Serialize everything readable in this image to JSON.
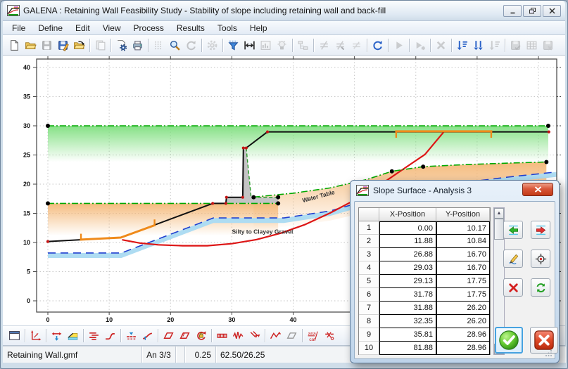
{
  "window": {
    "title": "GALENA : Retaining Wall Feasibility Study - Stability of slope including retaining wall and back-fill",
    "controls": [
      {
        "name": "minimize-button",
        "glyph": "minimize"
      },
      {
        "name": "restore-button",
        "glyph": "restore"
      },
      {
        "name": "close-button",
        "glyph": "close"
      }
    ]
  },
  "menu": {
    "items": [
      "File",
      "Define",
      "Edit",
      "View",
      "Process",
      "Results",
      "Tools",
      "Help"
    ]
  },
  "toolbar_top": {
    "items": [
      {
        "name": "new-file",
        "icon": "page"
      },
      {
        "name": "open-file",
        "icon": "folder"
      },
      {
        "name": "save-file",
        "icon": "floppy",
        "disabled": true
      },
      {
        "name": "save-edit-file",
        "icon": "floppy-pen"
      },
      {
        "name": "reopen-file",
        "icon": "folder-arrow"
      },
      {
        "sep": true
      },
      {
        "name": "paste",
        "icon": "paste",
        "disabled": true
      },
      {
        "sep": true
      },
      {
        "name": "page-setup",
        "icon": "page-gear"
      },
      {
        "name": "print",
        "icon": "printer"
      },
      {
        "sep": true
      },
      {
        "name": "grid-toggle",
        "icon": "grid-dots",
        "disabled": true
      },
      {
        "name": "zoom",
        "icon": "magnifier"
      },
      {
        "name": "redraw",
        "icon": "refresh",
        "disabled": true
      },
      {
        "sep": true
      },
      {
        "name": "settings",
        "icon": "gear",
        "disabled": true
      },
      {
        "sep": true
      },
      {
        "name": "filter",
        "icon": "funnel"
      },
      {
        "name": "fit-width",
        "icon": "fit-width"
      },
      {
        "name": "plot-options",
        "icon": "chart-frame",
        "disabled": true
      },
      {
        "name": "hint",
        "icon": "bulb",
        "disabled": true
      },
      {
        "sep": true
      },
      {
        "name": "model-tree",
        "icon": "tree",
        "disabled": true
      },
      {
        "sep": true
      },
      {
        "name": "edit-definition",
        "icon": "neq-pencil",
        "disabled": true
      },
      {
        "name": "edit-definition-alt",
        "icon": "neq-pencil2",
        "disabled": true
      },
      {
        "name": "edit-definition-lines",
        "icon": "neq-lines",
        "disabled": true
      },
      {
        "sep": true
      },
      {
        "name": "reprocess",
        "icon": "refresh-blue"
      },
      {
        "sep": true
      },
      {
        "name": "process",
        "icon": "play",
        "disabled": true
      },
      {
        "sep": true
      },
      {
        "name": "process-new",
        "icon": "play-star",
        "disabled": true
      },
      {
        "sep": true
      },
      {
        "name": "abort",
        "icon": "x-mark",
        "disabled": true
      },
      {
        "sep": true
      },
      {
        "name": "results-sort",
        "icon": "sort-lines"
      },
      {
        "name": "results-sort-all",
        "icon": "sort-double"
      },
      {
        "name": "results-sort-one",
        "icon": "sort-gray",
        "disabled": true
      },
      {
        "sep": true
      },
      {
        "name": "save-results",
        "icon": "floppy-check",
        "disabled": true
      },
      {
        "name": "results-table",
        "icon": "table-grid",
        "disabled": true
      },
      {
        "name": "clear-results",
        "icon": "floppy-x",
        "disabled": true
      }
    ]
  },
  "toolbar_bottom": {
    "items": [
      {
        "name": "page-frame",
        "icon": "win-frame"
      },
      {
        "sep": true
      },
      {
        "name": "axes-definition",
        "icon": "axes-red"
      },
      {
        "sep": true
      },
      {
        "name": "surface-profile",
        "icon": "prof-arrows"
      },
      {
        "name": "slope-batter",
        "icon": "slope-fill"
      },
      {
        "sep": true
      },
      {
        "name": "material-profiles",
        "icon": "multilines"
      },
      {
        "name": "profile-curve",
        "icon": "scurve"
      },
      {
        "sep": true
      },
      {
        "name": "water-table-define",
        "icon": "wt-icon"
      },
      {
        "name": "piezometric-surface",
        "icon": "piezo"
      },
      {
        "sep": true
      },
      {
        "name": "circular-surface",
        "icon": "para-red"
      },
      {
        "name": "circular-surface-multi",
        "icon": "para-red2"
      },
      {
        "name": "restraints",
        "icon": "lock-circ"
      },
      {
        "sep": true
      },
      {
        "name": "distributed-load",
        "icon": "dload"
      },
      {
        "name": "earthquake-load",
        "icon": "quake"
      },
      {
        "name": "point-load",
        "icon": "pload"
      },
      {
        "sep": true
      },
      {
        "name": "noncircular-surface",
        "icon": "noncirc"
      },
      {
        "name": "surface-alt",
        "icon": "para-gray"
      },
      {
        "sep": true
      },
      {
        "name": "analysis-catalogue",
        "icon": "anacat"
      },
      {
        "name": "section-cut",
        "icon": "axcut"
      }
    ]
  },
  "chart_data": {
    "type": "line",
    "title": "Slope cross-section with retaining wall, back-fill, water table and failure surface",
    "xlabel": "",
    "ylabel": "",
    "x_axis": {
      "min": -1.8,
      "max": 83,
      "tick_step": 10,
      "ticks": [
        0,
        10,
        20,
        30,
        40,
        50,
        60,
        70,
        80
      ],
      "labeled_ticks": [
        0,
        10,
        20,
        30,
        40
      ]
    },
    "y_axis": {
      "min": -2,
      "max": 41.5,
      "tick_step": 5,
      "ticks": [
        0,
        5,
        10,
        15,
        20,
        25,
        30,
        35,
        40
      ]
    },
    "grid": true,
    "series": {
      "ground_profile": {
        "color": "#101010",
        "points": [
          [
            0,
            10.17
          ],
          [
            11.88,
            10.84
          ],
          [
            26.88,
            16.7
          ],
          [
            29.03,
            16.7
          ],
          [
            29.13,
            17.75
          ],
          [
            31.78,
            17.75
          ],
          [
            31.88,
            26.2
          ],
          [
            32.35,
            26.2
          ],
          [
            35.81,
            28.96
          ],
          [
            81.88,
            28.96
          ]
        ]
      },
      "limit_line_upper": {
        "color": "#00a800",
        "style": "dash-dot",
        "points": [
          [
            0,
            30
          ],
          [
            81.6,
            30
          ]
        ]
      },
      "limit_line_lower": {
        "color": "#00a800",
        "style": "dash-dot",
        "points": [
          [
            0,
            16.7
          ],
          [
            37.55,
            16.7
          ]
        ]
      },
      "backfill_surface": {
        "color": "#00a800",
        "style": "dash-dot",
        "points": [
          [
            33.55,
            17.78
          ],
          [
            40,
            18.45
          ],
          [
            46,
            19.35
          ],
          [
            52,
            20.8
          ],
          [
            56.1,
            22.2
          ],
          [
            61.2,
            23.0
          ],
          [
            68,
            23.35
          ],
          [
            75,
            23.6
          ],
          [
            81.3,
            23.8
          ]
        ]
      },
      "water_table": {
        "color": "#2040d0",
        "style": "dashed",
        "points": [
          [
            0,
            8.2
          ],
          [
            12,
            8.2
          ],
          [
            27,
            14.2
          ],
          [
            38.5,
            14.2
          ],
          [
            46,
            15.4
          ],
          [
            55,
            18.1
          ],
          [
            65,
            19.9
          ],
          [
            75,
            21.2
          ],
          [
            83,
            22.1
          ]
        ]
      },
      "slip_surface": {
        "color": "#dd1515",
        "points": [
          [
            12.2,
            10.45
          ],
          [
            15,
            9.9
          ],
          [
            18,
            9.6
          ],
          [
            22,
            9.45
          ],
          [
            26,
            9.45
          ],
          [
            30,
            9.8
          ],
          [
            34,
            10.5
          ],
          [
            38,
            11.6
          ],
          [
            42,
            13.1
          ],
          [
            46,
            15.05
          ],
          [
            50,
            17.25
          ],
          [
            54,
            19.75
          ],
          [
            58,
            22.6
          ],
          [
            61.5,
            25.1
          ],
          [
            64.6,
            29.0
          ]
        ]
      },
      "retaining_wall": {
        "fill": "#c4c4c4",
        "polygon": [
          [
            29.03,
            16.7
          ],
          [
            29.13,
            17.75
          ],
          [
            31.78,
            17.75
          ],
          [
            31.88,
            26.2
          ],
          [
            32.35,
            26.2
          ],
          [
            33.15,
            17.75
          ],
          [
            37.55,
            17.75
          ],
          [
            37.55,
            16.7
          ]
        ],
        "dashed_face": [
          [
            32.35,
            26.2
          ],
          [
            33.15,
            17.75
          ],
          [
            37.55,
            17.75
          ]
        ]
      },
      "load_upper": {
        "color": "#ef8a1a",
        "line": [
          [
            56.8,
            29.05
          ],
          [
            72.3,
            29.05
          ]
        ],
        "hook_dy": -1.1
      },
      "load_lower": {
        "color": "#ef8a1a",
        "line": [
          [
            5.4,
            10.5
          ],
          [
            11.88,
            10.84
          ],
          [
            17.4,
            12.95
          ]
        ],
        "hook_dy": 1.0
      },
      "black_markers": [
        [
          0,
          30
        ],
        [
          81.6,
          30
        ],
        [
          0,
          16.7
        ],
        [
          33.55,
          17.75
        ],
        [
          37.55,
          17.75
        ],
        [
          37.55,
          16.7
        ],
        [
          56.1,
          22.2
        ],
        [
          61.2,
          23.0
        ],
        [
          81.3,
          23.8
        ]
      ],
      "red_markers": [
        [
          0,
          10.17
        ],
        [
          26.88,
          16.7
        ],
        [
          29.03,
          16.7
        ],
        [
          29.13,
          17.75
        ],
        [
          31.78,
          17.75
        ],
        [
          31.88,
          26.2
        ],
        [
          32.35,
          26.2
        ],
        [
          35.81,
          28.96
        ],
        [
          81.7,
          28.96
        ]
      ]
    },
    "annotations": [
      {
        "text": "Water Table",
        "x": 41.6,
        "y": 16.85,
        "angle": -15
      },
      {
        "text": "Silty to Clayey Gravel",
        "x": 35.0,
        "y": 11.5,
        "angle": 0
      }
    ],
    "colors": {
      "green_fill": "#7fdf7f",
      "orange_fill": "#f4b878",
      "water_band": "#aedcf2"
    }
  },
  "dialog": {
    "title": "Slope Surface - Analysis 3",
    "close_glyph": "X",
    "table": {
      "headers": [
        "X-Position",
        "Y-Position"
      ],
      "rows": [
        [
          1,
          "0.00",
          "10.17"
        ],
        [
          2,
          "11.88",
          "10.84"
        ],
        [
          3,
          "26.88",
          "16.70"
        ],
        [
          4,
          "29.03",
          "16.70"
        ],
        [
          5,
          "29.13",
          "17.75"
        ],
        [
          6,
          "31.78",
          "17.75"
        ],
        [
          7,
          "31.88",
          "26.20"
        ],
        [
          8,
          "32.35",
          "26.20"
        ],
        [
          9,
          "35.81",
          "28.96"
        ],
        [
          10,
          "81.88",
          "28.96"
        ]
      ]
    },
    "side_buttons": [
      {
        "name": "move-point-left-button",
        "icon": "arr-left-green",
        "col": 0,
        "row": 0
      },
      {
        "name": "move-point-right-button",
        "icon": "arr-right-red",
        "col": 1,
        "row": 0
      },
      {
        "name": "edit-point-button",
        "icon": "edit-pencil",
        "col": 0,
        "row": 1
      },
      {
        "name": "locate-point-button",
        "icon": "crosshair",
        "col": 1,
        "row": 1
      },
      {
        "name": "delete-point-button",
        "icon": "red-x",
        "col": 0,
        "row": 2
      },
      {
        "name": "refresh-points-button",
        "icon": "green-cycle",
        "col": 1,
        "row": 2
      }
    ],
    "ok_button": "accept",
    "cancel_button": "cancel"
  },
  "status_bar": {
    "file": "Retaining Wall.gmf",
    "analysis": "An 3/3",
    "spare": "",
    "grid_snap": "0.25",
    "coordinates": "62.50/26.25"
  }
}
